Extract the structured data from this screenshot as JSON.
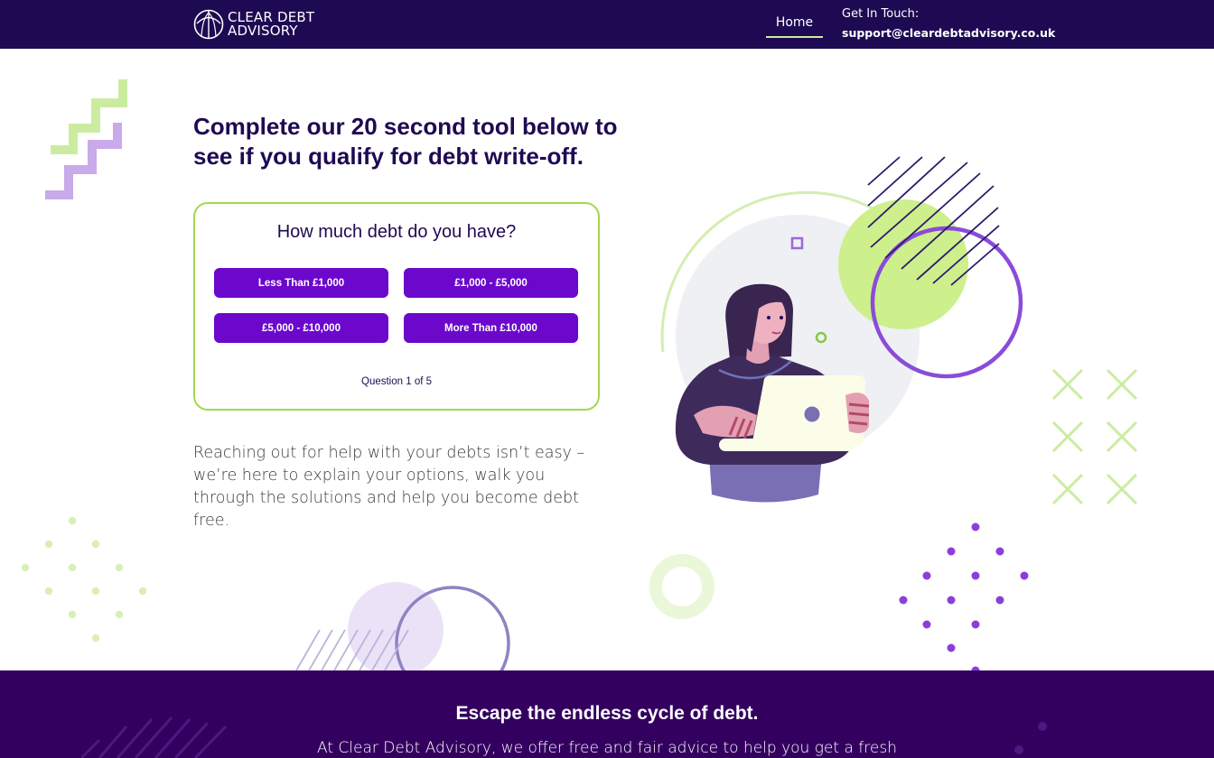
{
  "header": {
    "logo_line1": "CLEAR DEBT",
    "logo_line2": "ADVISORY",
    "logo_icon": "umbrella-icon",
    "nav": {
      "home_label": "Home"
    },
    "contact": {
      "label": "Get In Touch:",
      "email": "support@cleardebtadvisory.co.uk"
    }
  },
  "main": {
    "headline": "Complete our 20 second tool below to see if you qualify for debt write-off.",
    "quiz": {
      "question": "How much debt do you have?",
      "options": [
        "Less Than £1,000",
        "£1,000 - £5,000",
        "£5,000 - £10,000",
        "More Than £10,000"
      ],
      "progress": "Question 1 of 5"
    },
    "body_text": "Reaching out for help with your debts isn’t easy – we’re here to explain your options, walk you through the solutions and help you become debt free."
  },
  "footer": {
    "title": "Escape the endless cycle of debt.",
    "text": "At Clear Debt Advisory, we offer free and fair advice to help you get a fresh"
  },
  "colors": {
    "header_bg": "#1e0a52",
    "button": "#6b08cc",
    "accent_green": "#a2d94e",
    "footer_bg": "#33005f",
    "text_dark": "#1e0a52"
  }
}
